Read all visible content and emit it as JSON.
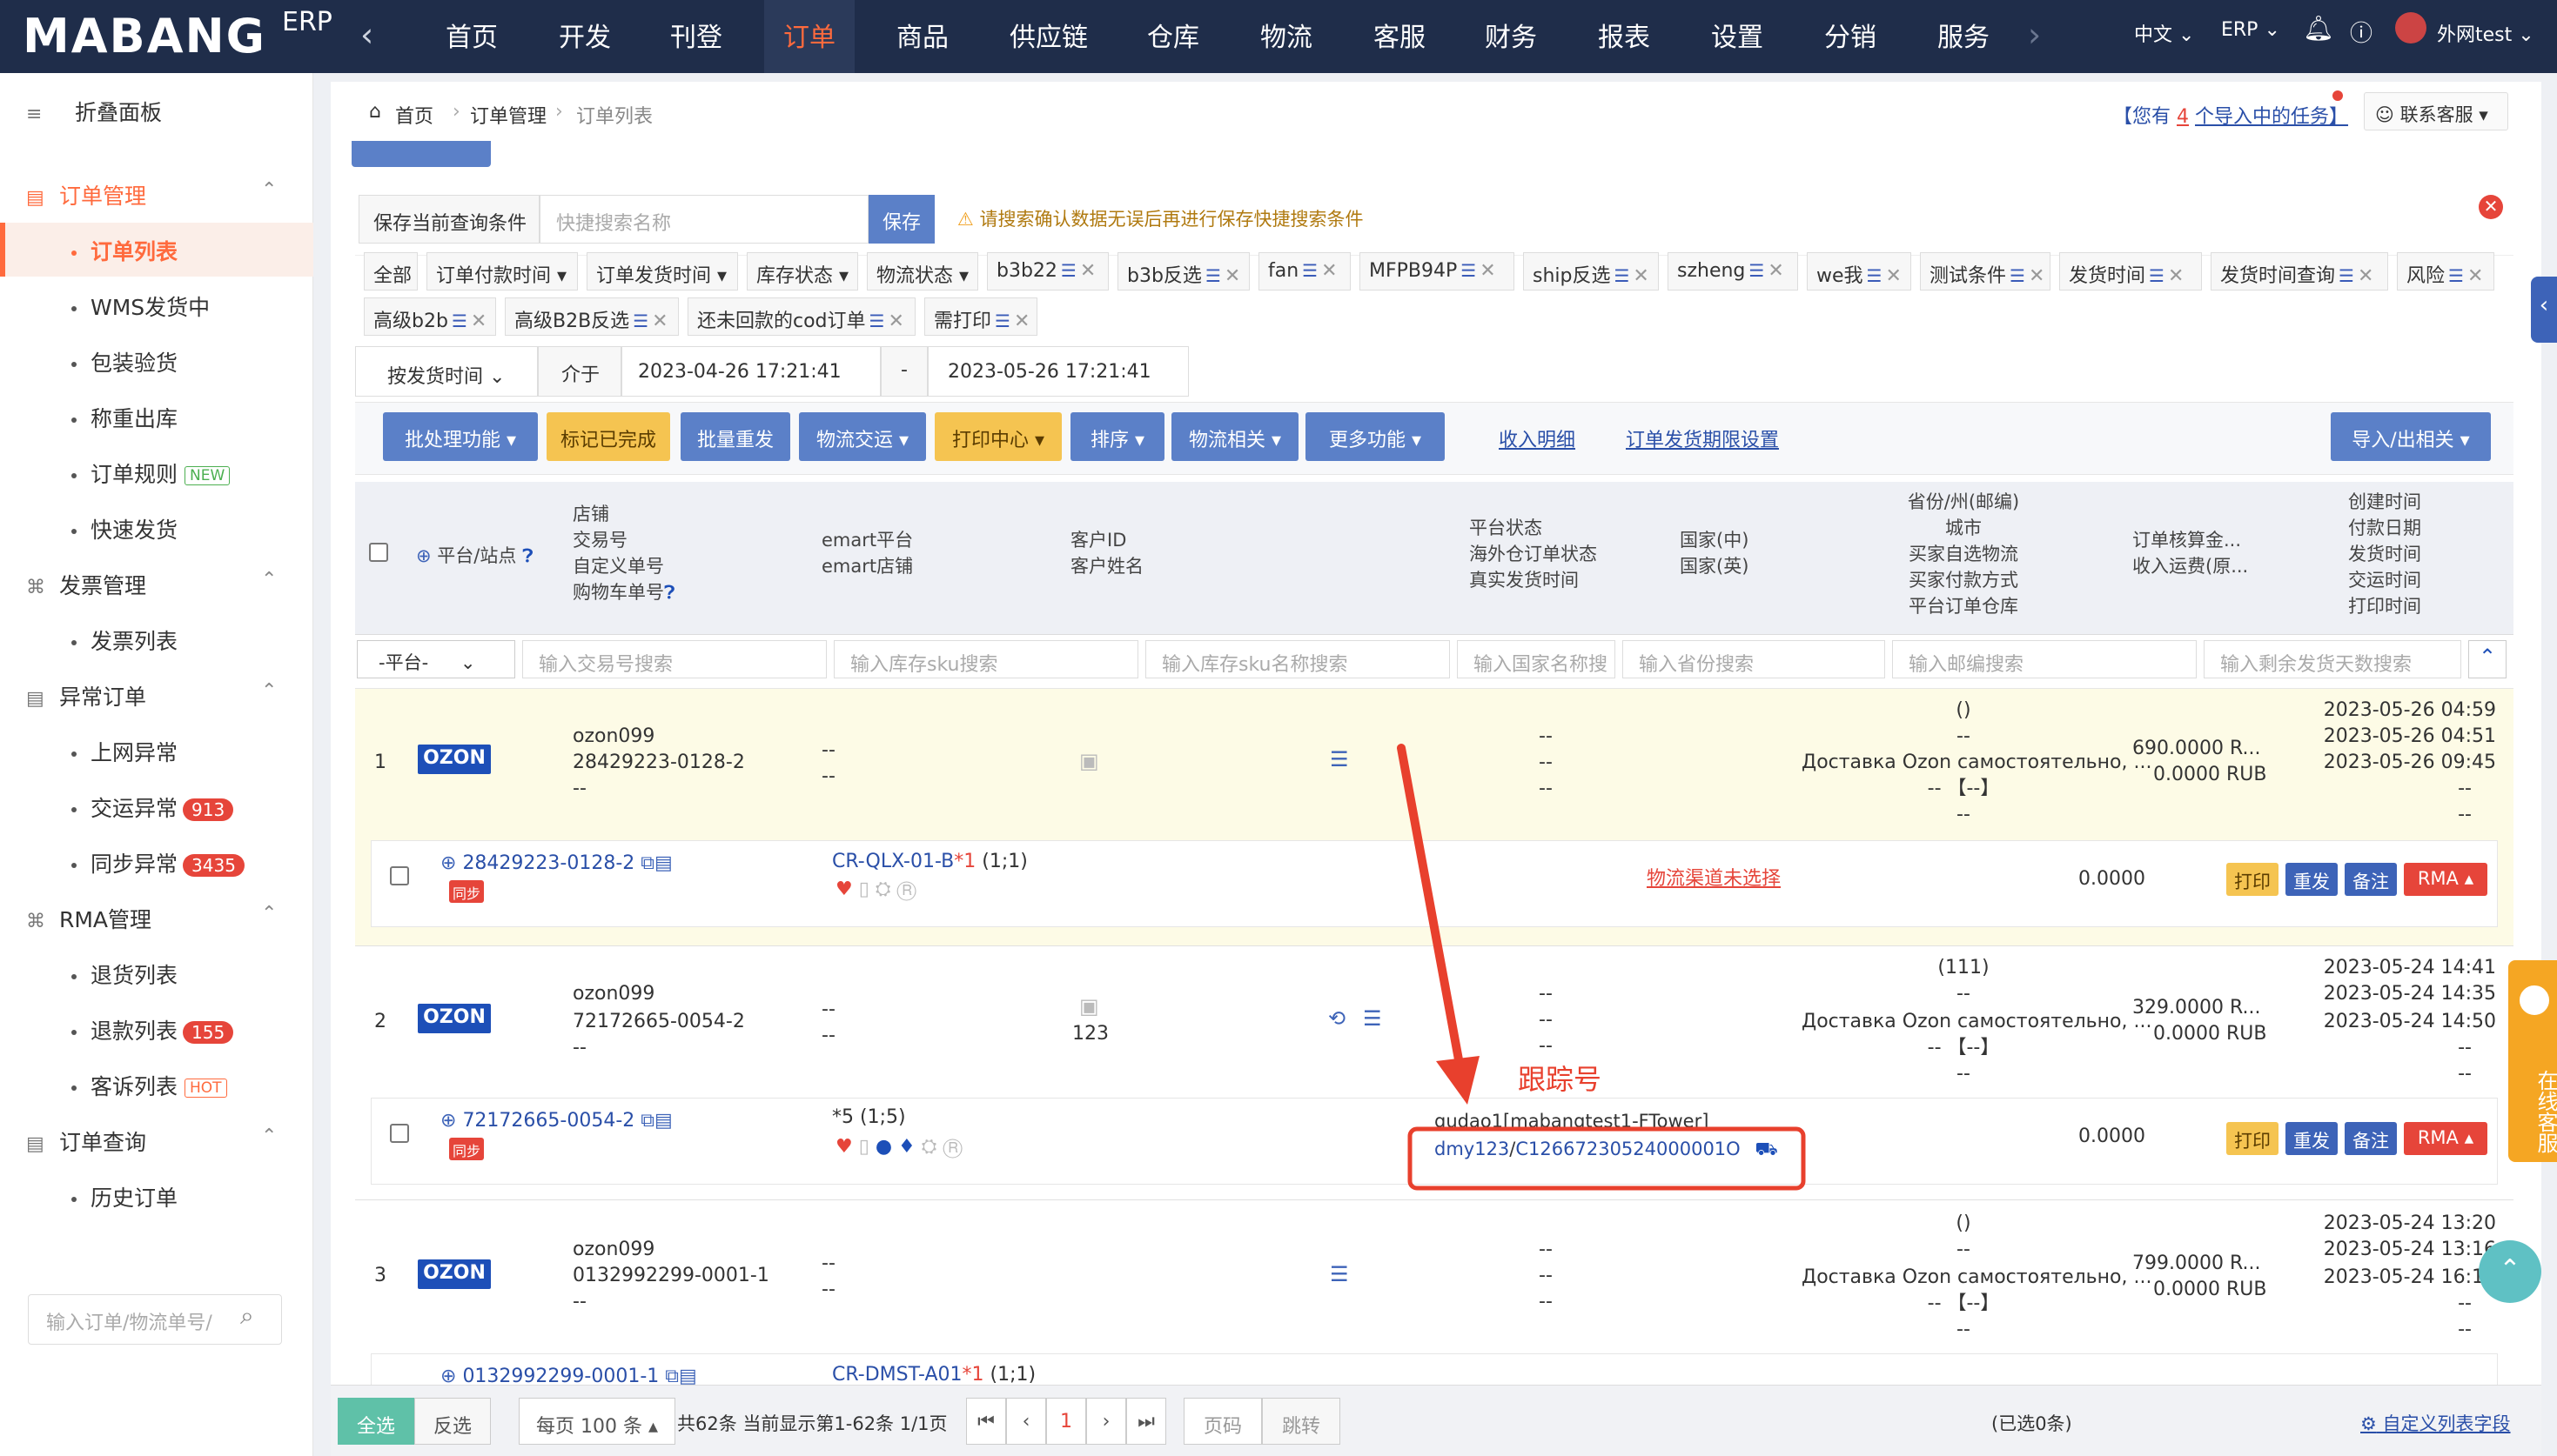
{
  "topnav": {
    "logo": "MABANG",
    "logo_suffix": "ERP",
    "items": [
      "首页",
      "开发",
      "刊登",
      "订单",
      "商品",
      "供应链",
      "仓库",
      "物流",
      "客服",
      "财务",
      "报表",
      "设置",
      "分销",
      "服务"
    ],
    "active_index": 3,
    "lang": "中文",
    "erp_menu": "ERP",
    "user": "外网test"
  },
  "sidebar": {
    "collapse": "折叠面板",
    "groups": [
      {
        "label": "订单管理",
        "items": [
          {
            "label": "订单列表",
            "active": true
          },
          {
            "label": "WMS发货中"
          },
          {
            "label": "包装验货"
          },
          {
            "label": "称重出库"
          },
          {
            "label": "订单规则",
            "tag": "NEW"
          },
          {
            "label": "快速发货"
          }
        ]
      },
      {
        "label": "发票管理",
        "items": [
          {
            "label": "发票列表"
          }
        ]
      },
      {
        "label": "异常订单",
        "items": [
          {
            "label": "上网异常"
          },
          {
            "label": "交运异常",
            "badge": "913"
          },
          {
            "label": "同步异常",
            "badge": "3435"
          }
        ]
      },
      {
        "label": "RMA管理",
        "items": [
          {
            "label": "退货列表"
          },
          {
            "label": "退款列表",
            "badge": "155"
          },
          {
            "label": "客诉列表",
            "tag": "HOT"
          }
        ]
      },
      {
        "label": "订单查询",
        "items": [
          {
            "label": "历史订单"
          }
        ]
      }
    ],
    "search_placeholder": "输入订单/物流单号/"
  },
  "breadcrumb": {
    "home": "首页",
    "level1": "订单管理",
    "level2": "订单列表"
  },
  "tasks": {
    "prefix": "【您有",
    "count": "4",
    "suffix": "个导入中的任务】"
  },
  "support": "联系客服",
  "save_query": {
    "label": "保存当前查询条件",
    "placeholder": "快捷搜索名称",
    "button": "保存",
    "warning": "请搜索确认数据无误后再进行保存快捷搜索条件"
  },
  "filter_tags_row1": [
    "全部",
    "订单付款时间",
    "订单发货时间",
    "库存状态",
    "物流状态",
    "b3b22",
    "b3b反选",
    "fan",
    "MFPB94P",
    "ship反选",
    "szheng",
    "we我",
    "测试条件",
    "发货时间",
    "发货时间查询",
    "风险"
  ],
  "filter_tags_row2": [
    "高级b2b",
    "高级B2B反选",
    "还未回款的cod订单",
    "需打印"
  ],
  "date_filter": {
    "type": "按发货时间",
    "between": "介于",
    "start": "2023-04-26 17:21:41",
    "dash": "-",
    "end": "2023-05-26 17:21:41"
  },
  "toolbar": {
    "batch": "批处理功能",
    "mark_done": "标记已完成",
    "batch_resend": "批量重发",
    "logistics_ship": "物流交运",
    "print_center": "打印中心",
    "sort": "排序",
    "logistics_related": "物流相关",
    "more": "更多功能",
    "income_detail": "收入明细",
    "deadline_setting": "订单发货期限设置",
    "import_export": "导入/出相关"
  },
  "table_header": {
    "platform": "平台/站点",
    "col_shop": [
      "店铺",
      "交易号",
      "自定义单号",
      "购物车单号"
    ],
    "col_emart": [
      "emart平台",
      "emart店铺"
    ],
    "col_customer": [
      "客户ID",
      "客户姓名"
    ],
    "col_status": [
      "平台状态",
      "海外仓订单状态",
      "真实发货时间"
    ],
    "col_country": [
      "国家(中)",
      "国家(英)"
    ],
    "col_region": [
      "省份/州(邮编)",
      "城市",
      "买家自选物流",
      "买家付款方式",
      "平台订单仓库"
    ],
    "col_amount": [
      "订单核算金...",
      "收入运费(原..."
    ],
    "col_time": [
      "创建时间",
      "付款日期",
      "发货时间",
      "交运时间",
      "打印时间"
    ]
  },
  "search_row": {
    "platform_select": "-平台-",
    "placeholders": [
      "输入交易号搜索",
      "输入库存sku搜索",
      "输入库存sku名称搜索",
      "输入国家名称搜",
      "输入省份搜索",
      "输入邮编搜索",
      "输入剩余发货天数搜索"
    ]
  },
  "orders": [
    {
      "index": "1",
      "platform": "OZON",
      "shop": "ozon099",
      "trade_no": "28429223-0128-2",
      "custom_no": "--",
      "emart": [
        "--",
        "--"
      ],
      "status": [
        "--",
        "--",
        "--"
      ],
      "region": [
        "()",
        "--",
        "Доставка Ozon самостоятельно, ...",
        "-- 【--】",
        "--"
      ],
      "amount": [
        "690.0000 R...",
        "0.0000 RUB"
      ],
      "times": [
        "2023-05-26 04:59",
        "2023-05-26 04:51",
        "2023-05-26 09:45",
        "--",
        "--"
      ],
      "sub": {
        "order_no": "28429223-0128-2",
        "sync": "同步",
        "sku": "CR-QLX-01-B",
        "qty": "*1",
        "qty_info": "(1;1)",
        "logistics": "物流渠道未选择",
        "value": "0.0000"
      }
    },
    {
      "index": "2",
      "platform": "OZON",
      "shop": "ozon099",
      "trade_no": "72172665-0054-2",
      "custom_no": "--",
      "emart": [
        "--",
        "--"
      ],
      "customer": "123",
      "status": [
        "--",
        "--",
        "--"
      ],
      "region": [
        "(111)",
        "--",
        "Доставка Ozon самостоятельно, ...",
        "-- 【--】",
        "--"
      ],
      "amount": [
        "329.0000 R...",
        "0.0000 RUB"
      ],
      "times": [
        "2023-05-24 14:41",
        "2023-05-24 14:35",
        "2023-05-24 14:50",
        "--",
        "--"
      ],
      "sub": {
        "order_no": "72172665-0054-2",
        "sync": "同步",
        "sku": "",
        "qty": "*5",
        "qty_info": "(1;5)",
        "carrier": "gudao1[mabangtest1-FTower]",
        "tracking_prefix": "dmy123",
        "tracking_sep": "/",
        "tracking_no": "C12667230524000001O",
        "value": "0.0000"
      }
    },
    {
      "index": "3",
      "platform": "OZON",
      "shop": "ozon099",
      "trade_no": "0132992299-0001-1",
      "custom_no": "--",
      "emart": [
        "--",
        "--"
      ],
      "status": [
        "--",
        "--",
        "--"
      ],
      "region": [
        "()",
        "--",
        "Доставка Ozon самостоятельно, ...",
        "-- 【--】",
        "--"
      ],
      "amount": [
        "799.0000 R...",
        "0.0000 RUB"
      ],
      "times": [
        "2023-05-24 13:20",
        "2023-05-24 13:16",
        "2023-05-24 16:14",
        "--",
        "--"
      ],
      "sub": {
        "order_no": "0132992299-0001-1",
        "sku": "CR-DMST-A01",
        "qty": "*1",
        "qty_info": "(1;1)"
      }
    }
  ],
  "row_actions": {
    "print": "打印",
    "resend": "重发",
    "note": "备注",
    "rma": "RMA"
  },
  "annotation": {
    "label": "跟踪号",
    "color": "#e8402d"
  },
  "online_service": "在线客服",
  "pager": {
    "select_all": "全选",
    "invert": "反选",
    "per_page": "每页 100 条",
    "summary": "共62条 当前显示第1-62条 1/1页",
    "page": "1",
    "page_input": "页码",
    "jump": "跳转",
    "selected": "(已选0条)",
    "custom_columns": "自定义列表字段"
  },
  "colors": {
    "nav_bg": "#1f2d4a",
    "accent": "#ff6a3d",
    "primary": "#5b80c8",
    "ozon": "#1d4fb8",
    "danger": "#e6453a",
    "warning": "#f5c451",
    "highlight_row": "#fdfbe6"
  }
}
